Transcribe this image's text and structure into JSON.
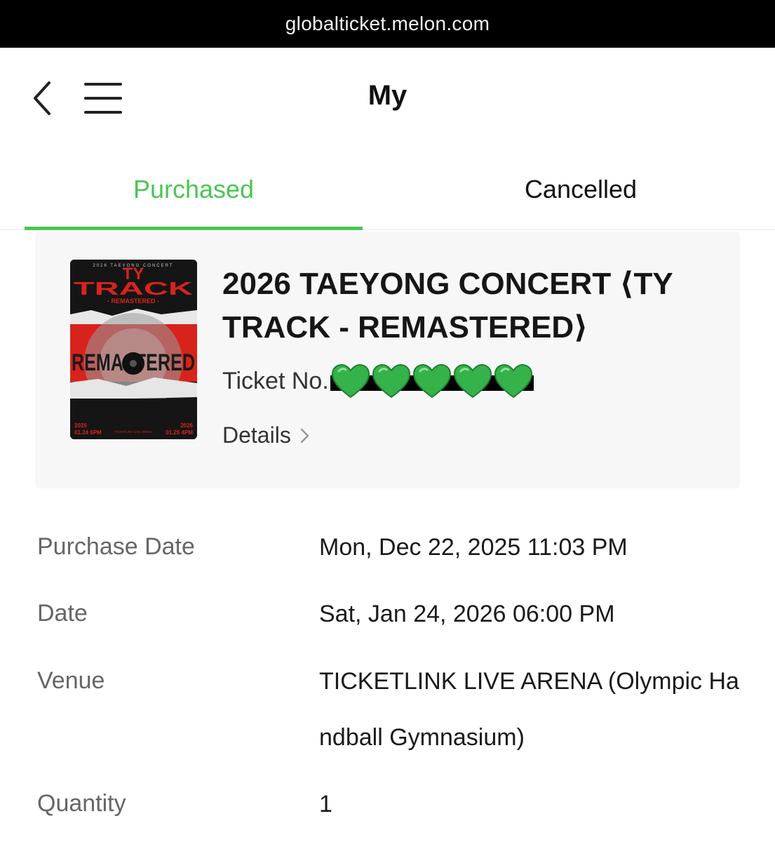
{
  "browser": {
    "url": "globalticket.melon.com"
  },
  "header": {
    "title": "My",
    "back_icon": "chevron-left-icon",
    "menu_icon": "hamburger-menu-icon"
  },
  "tabs": [
    {
      "label": "Purchased",
      "active": true
    },
    {
      "label": "Cancelled",
      "active": false
    }
  ],
  "colors": {
    "accent": "#4bc653",
    "card_bg": "#f7f7f7",
    "label_gray": "#666666",
    "poster_red": "#d8231c"
  },
  "ticket": {
    "title": "2026 TAEYONG CONCERT ⟨TY TRACK - REMASTERED⟩",
    "ticket_no_label": "Ticket No.",
    "ticket_no_masked_icon": "green-heart-icon",
    "details_label": "Details",
    "poster": {
      "top_text": "2026 TAEYONG CONCERT",
      "main_line1": "TY",
      "main_line2": "TRACK",
      "sub": "- REMASTERED -",
      "center": "REMASTERED",
      "date_left_year": "2026",
      "date_left": "01.24 6PM",
      "date_right_year": "2026",
      "date_right": "01.25 4PM",
      "venue_small": "TICKETLINK LIVE ARENA"
    }
  },
  "info": {
    "purchase_date_label": "Purchase Date",
    "purchase_date_value": "Mon, Dec 22, 2025 11:03 PM",
    "date_label": "Date",
    "date_value": "Sat, Jan 24, 2026 06:00 PM",
    "venue_label": "Venue",
    "venue_value_line1": "TICKETLINK LIVE ARENA (Olympic Ha",
    "venue_value_line2": "ndball Gymnasium)",
    "quantity_label": "Quantity",
    "quantity_value": "1"
  }
}
